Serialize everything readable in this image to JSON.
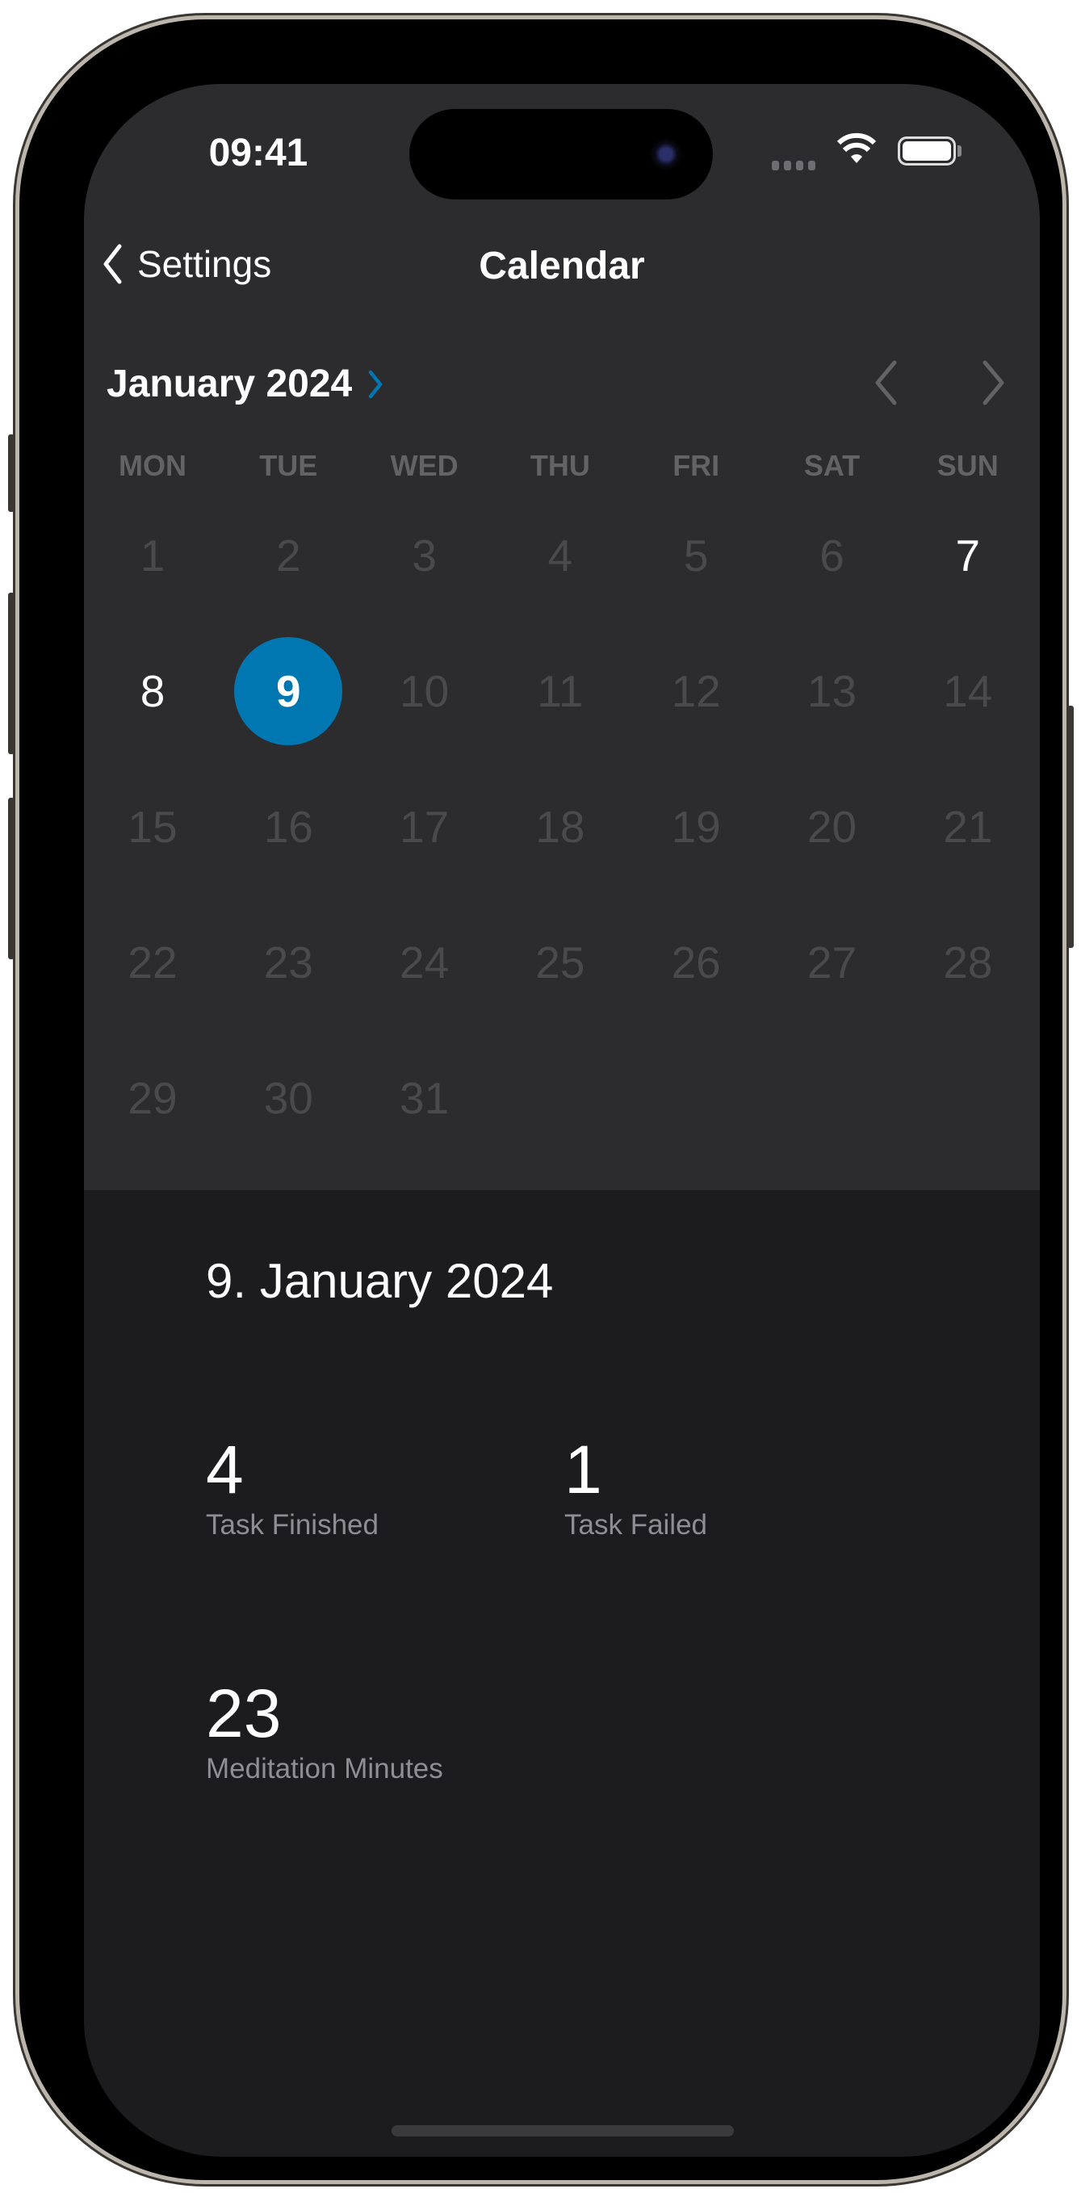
{
  "status_bar": {
    "time": "09:41",
    "wifi_icon": "wifi-icon",
    "battery_icon": "battery-icon"
  },
  "nav": {
    "back_label": "Settings",
    "title": "Calendar"
  },
  "calendar": {
    "month_label": "January 2024",
    "weekdays": [
      "MON",
      "TUE",
      "WED",
      "THU",
      "FRI",
      "SAT",
      "SUN"
    ],
    "days": [
      "1",
      "2",
      "3",
      "4",
      "5",
      "6",
      "7",
      "8",
      "9",
      "10",
      "11",
      "12",
      "13",
      "14",
      "15",
      "16",
      "17",
      "18",
      "19",
      "20",
      "21",
      "22",
      "23",
      "24",
      "25",
      "26",
      "27",
      "28",
      "29",
      "30",
      "31"
    ],
    "first_weekday_index": 0,
    "selected_day": "9",
    "highlighted_days": [
      "7",
      "8"
    ],
    "accent_color": "#0077B0"
  },
  "detail": {
    "date_title": "9. January 2024",
    "stats": [
      {
        "value": "4",
        "label": "Task Finished"
      },
      {
        "value": "1",
        "label": "Task Failed"
      },
      {
        "value": "23",
        "label": "Meditation Minutes"
      }
    ]
  }
}
